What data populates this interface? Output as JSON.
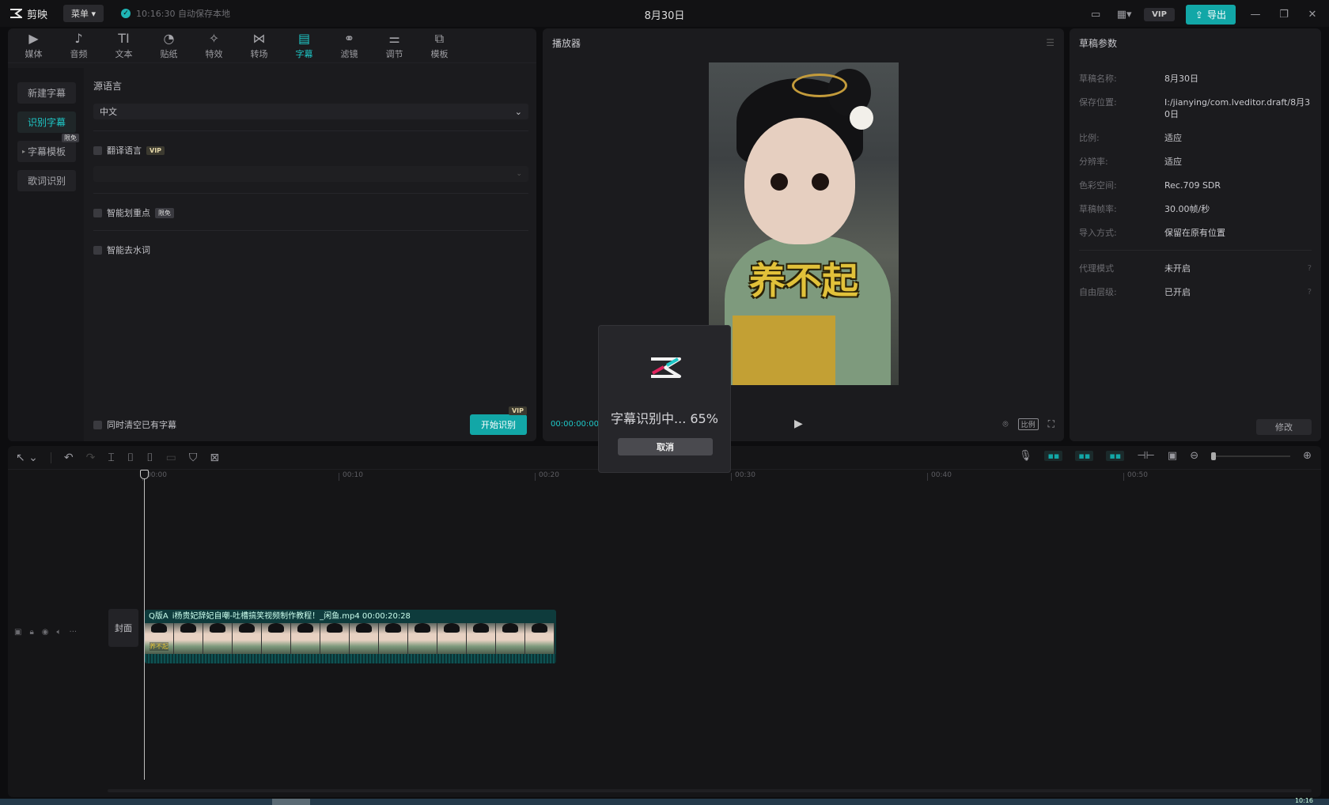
{
  "app": {
    "name": "剪映",
    "menu_label": "菜单",
    "autosave_text": "10:16:30 自动保存本地",
    "project_title": "8月30日",
    "vip_label": "VIP",
    "export_label": "导出"
  },
  "tools": [
    {
      "label": "媒体",
      "icon": "media-icon"
    },
    {
      "label": "音频",
      "icon": "audio-icon"
    },
    {
      "label": "文本",
      "icon": "text-icon"
    },
    {
      "label": "贴纸",
      "icon": "sticker-icon"
    },
    {
      "label": "特效",
      "icon": "effects-icon"
    },
    {
      "label": "转场",
      "icon": "transition-icon"
    },
    {
      "label": "字幕",
      "icon": "subtitle-icon",
      "active": true
    },
    {
      "label": "滤镜",
      "icon": "filter-icon"
    },
    {
      "label": "调节",
      "icon": "adjust-icon"
    },
    {
      "label": "模板",
      "icon": "template-icon"
    }
  ],
  "side_nav": {
    "new_subtitle": "新建字幕",
    "recognize_subtitle": "识别字幕",
    "subtitle_template": "字幕模板",
    "free_tag": "限免",
    "lyrics_recognition": "歌词识别"
  },
  "recognize": {
    "source_language_label": "源语言",
    "source_language_value": "中文",
    "translate_label": "翻译语言",
    "vip_tag": "VIP",
    "smart_split_label": "智能划重点",
    "free_tag": "限免",
    "remove_filler_label": "智能去水词",
    "clear_existing_label": "同时清空已有字幕",
    "start_button": "开始识别"
  },
  "player": {
    "header": "播放器",
    "caption_text": "养不起",
    "timecode": "00:00:00:00",
    "ratio_label": "比例"
  },
  "draft": {
    "header": "草稿参数",
    "rows": [
      {
        "k": "草稿名称:",
        "v": "8月30日"
      },
      {
        "k": "保存位置:",
        "v": "I:/jianying/com.lveditor.draft/8月30日"
      },
      {
        "k": "比例:",
        "v": "适应"
      },
      {
        "k": "分辨率:",
        "v": "适应"
      },
      {
        "k": "色彩空间:",
        "v": "Rec.709 SDR"
      },
      {
        "k": "草稿帧率:",
        "v": "30.00帧/秒"
      },
      {
        "k": "导入方式:",
        "v": "保留在原有位置"
      }
    ],
    "rows2": [
      {
        "k": "代理模式",
        "v": "未开启"
      },
      {
        "k": "自由层级:",
        "v": "已开启"
      }
    ],
    "edit_button": "修改"
  },
  "timeline": {
    "ticks": [
      "00:00",
      "00:10",
      "00:20",
      "00:30",
      "00:40",
      "00:50"
    ],
    "cover_label": "封面",
    "clip_title": "Q版A i杨贵妃辞妃自嘲-吐槽搞笑视频制作教程！_闲鱼.mp4   00:00:20:28",
    "clip_subtitle": "养不起"
  },
  "taskbar": {
    "time": "10:16"
  },
  "modal": {
    "status_text": "字幕识别中... 65%",
    "progress": 0.65,
    "cancel_label": "取消"
  },
  "colors": {
    "accent": "#1ec8c8",
    "button": "#12a7a7",
    "caption": "#e1c13a"
  }
}
